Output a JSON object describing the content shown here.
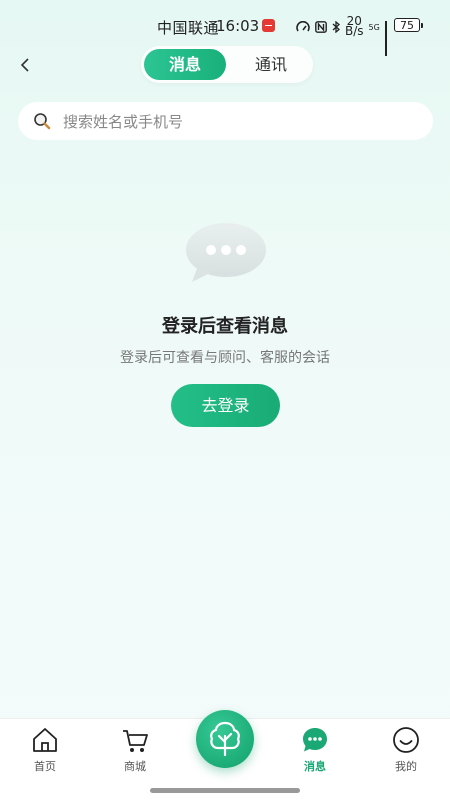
{
  "status_bar": {
    "carrier": "中国联通",
    "time": "16:03",
    "net_speed_value": "20",
    "net_speed_unit": "B/s",
    "network": "5G",
    "battery": "75"
  },
  "header": {
    "tabs": [
      {
        "label": "消息",
        "active": true
      },
      {
        "label": "通讯",
        "active": false
      }
    ]
  },
  "search": {
    "placeholder": "搜索姓名或手机号"
  },
  "empty_state": {
    "title": "登录后查看消息",
    "subtitle": "登录后可查看与顾问、客服的会话",
    "button_label": "去登录"
  },
  "bottom_nav": {
    "items": [
      {
        "label": "首页",
        "icon": "home-icon",
        "active": false
      },
      {
        "label": "商城",
        "icon": "cart-icon",
        "active": false
      },
      {
        "label": "消息",
        "icon": "chat-bubble-icon",
        "active": true
      },
      {
        "label": "我的",
        "icon": "smile-face-icon",
        "active": false
      }
    ],
    "center_icon": "tree-logo-icon"
  },
  "colors": {
    "accent": "#1aa874",
    "background_top": "#e6f8f3",
    "text_primary": "#222222",
    "text_secondary": "#777777"
  }
}
